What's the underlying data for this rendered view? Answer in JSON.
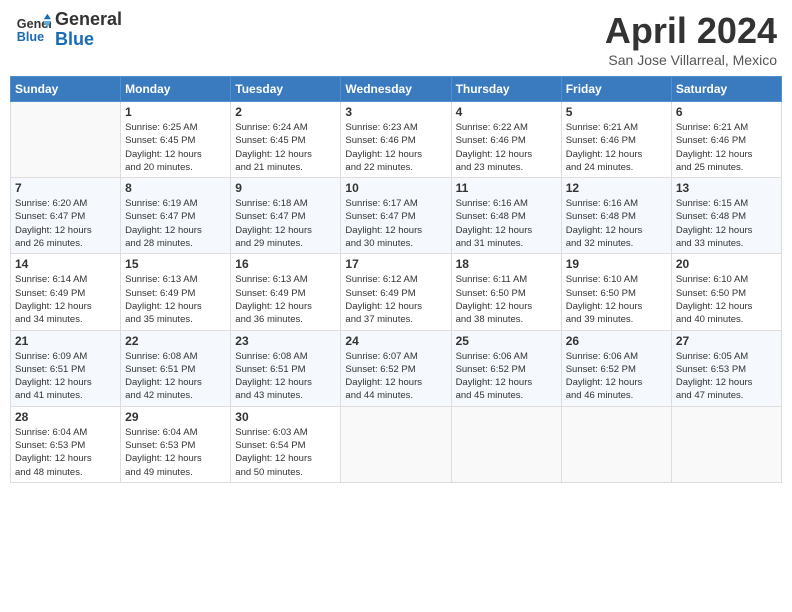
{
  "header": {
    "logo_general": "General",
    "logo_blue": "Blue",
    "month_title": "April 2024",
    "location": "San Jose Villarreal, Mexico"
  },
  "days_of_week": [
    "Sunday",
    "Monday",
    "Tuesday",
    "Wednesday",
    "Thursday",
    "Friday",
    "Saturday"
  ],
  "weeks": [
    [
      {
        "day": "",
        "info": ""
      },
      {
        "day": "1",
        "info": "Sunrise: 6:25 AM\nSunset: 6:45 PM\nDaylight: 12 hours\nand 20 minutes."
      },
      {
        "day": "2",
        "info": "Sunrise: 6:24 AM\nSunset: 6:45 PM\nDaylight: 12 hours\nand 21 minutes."
      },
      {
        "day": "3",
        "info": "Sunrise: 6:23 AM\nSunset: 6:46 PM\nDaylight: 12 hours\nand 22 minutes."
      },
      {
        "day": "4",
        "info": "Sunrise: 6:22 AM\nSunset: 6:46 PM\nDaylight: 12 hours\nand 23 minutes."
      },
      {
        "day": "5",
        "info": "Sunrise: 6:21 AM\nSunset: 6:46 PM\nDaylight: 12 hours\nand 24 minutes."
      },
      {
        "day": "6",
        "info": "Sunrise: 6:21 AM\nSunset: 6:46 PM\nDaylight: 12 hours\nand 25 minutes."
      }
    ],
    [
      {
        "day": "7",
        "info": "Sunrise: 6:20 AM\nSunset: 6:47 PM\nDaylight: 12 hours\nand 26 minutes."
      },
      {
        "day": "8",
        "info": "Sunrise: 6:19 AM\nSunset: 6:47 PM\nDaylight: 12 hours\nand 28 minutes."
      },
      {
        "day": "9",
        "info": "Sunrise: 6:18 AM\nSunset: 6:47 PM\nDaylight: 12 hours\nand 29 minutes."
      },
      {
        "day": "10",
        "info": "Sunrise: 6:17 AM\nSunset: 6:47 PM\nDaylight: 12 hours\nand 30 minutes."
      },
      {
        "day": "11",
        "info": "Sunrise: 6:16 AM\nSunset: 6:48 PM\nDaylight: 12 hours\nand 31 minutes."
      },
      {
        "day": "12",
        "info": "Sunrise: 6:16 AM\nSunset: 6:48 PM\nDaylight: 12 hours\nand 32 minutes."
      },
      {
        "day": "13",
        "info": "Sunrise: 6:15 AM\nSunset: 6:48 PM\nDaylight: 12 hours\nand 33 minutes."
      }
    ],
    [
      {
        "day": "14",
        "info": "Sunrise: 6:14 AM\nSunset: 6:49 PM\nDaylight: 12 hours\nand 34 minutes."
      },
      {
        "day": "15",
        "info": "Sunrise: 6:13 AM\nSunset: 6:49 PM\nDaylight: 12 hours\nand 35 minutes."
      },
      {
        "day": "16",
        "info": "Sunrise: 6:13 AM\nSunset: 6:49 PM\nDaylight: 12 hours\nand 36 minutes."
      },
      {
        "day": "17",
        "info": "Sunrise: 6:12 AM\nSunset: 6:49 PM\nDaylight: 12 hours\nand 37 minutes."
      },
      {
        "day": "18",
        "info": "Sunrise: 6:11 AM\nSunset: 6:50 PM\nDaylight: 12 hours\nand 38 minutes."
      },
      {
        "day": "19",
        "info": "Sunrise: 6:10 AM\nSunset: 6:50 PM\nDaylight: 12 hours\nand 39 minutes."
      },
      {
        "day": "20",
        "info": "Sunrise: 6:10 AM\nSunset: 6:50 PM\nDaylight: 12 hours\nand 40 minutes."
      }
    ],
    [
      {
        "day": "21",
        "info": "Sunrise: 6:09 AM\nSunset: 6:51 PM\nDaylight: 12 hours\nand 41 minutes."
      },
      {
        "day": "22",
        "info": "Sunrise: 6:08 AM\nSunset: 6:51 PM\nDaylight: 12 hours\nand 42 minutes."
      },
      {
        "day": "23",
        "info": "Sunrise: 6:08 AM\nSunset: 6:51 PM\nDaylight: 12 hours\nand 43 minutes."
      },
      {
        "day": "24",
        "info": "Sunrise: 6:07 AM\nSunset: 6:52 PM\nDaylight: 12 hours\nand 44 minutes."
      },
      {
        "day": "25",
        "info": "Sunrise: 6:06 AM\nSunset: 6:52 PM\nDaylight: 12 hours\nand 45 minutes."
      },
      {
        "day": "26",
        "info": "Sunrise: 6:06 AM\nSunset: 6:52 PM\nDaylight: 12 hours\nand 46 minutes."
      },
      {
        "day": "27",
        "info": "Sunrise: 6:05 AM\nSunset: 6:53 PM\nDaylight: 12 hours\nand 47 minutes."
      }
    ],
    [
      {
        "day": "28",
        "info": "Sunrise: 6:04 AM\nSunset: 6:53 PM\nDaylight: 12 hours\nand 48 minutes."
      },
      {
        "day": "29",
        "info": "Sunrise: 6:04 AM\nSunset: 6:53 PM\nDaylight: 12 hours\nand 49 minutes."
      },
      {
        "day": "30",
        "info": "Sunrise: 6:03 AM\nSunset: 6:54 PM\nDaylight: 12 hours\nand 50 minutes."
      },
      {
        "day": "",
        "info": ""
      },
      {
        "day": "",
        "info": ""
      },
      {
        "day": "",
        "info": ""
      },
      {
        "day": "",
        "info": ""
      }
    ]
  ]
}
